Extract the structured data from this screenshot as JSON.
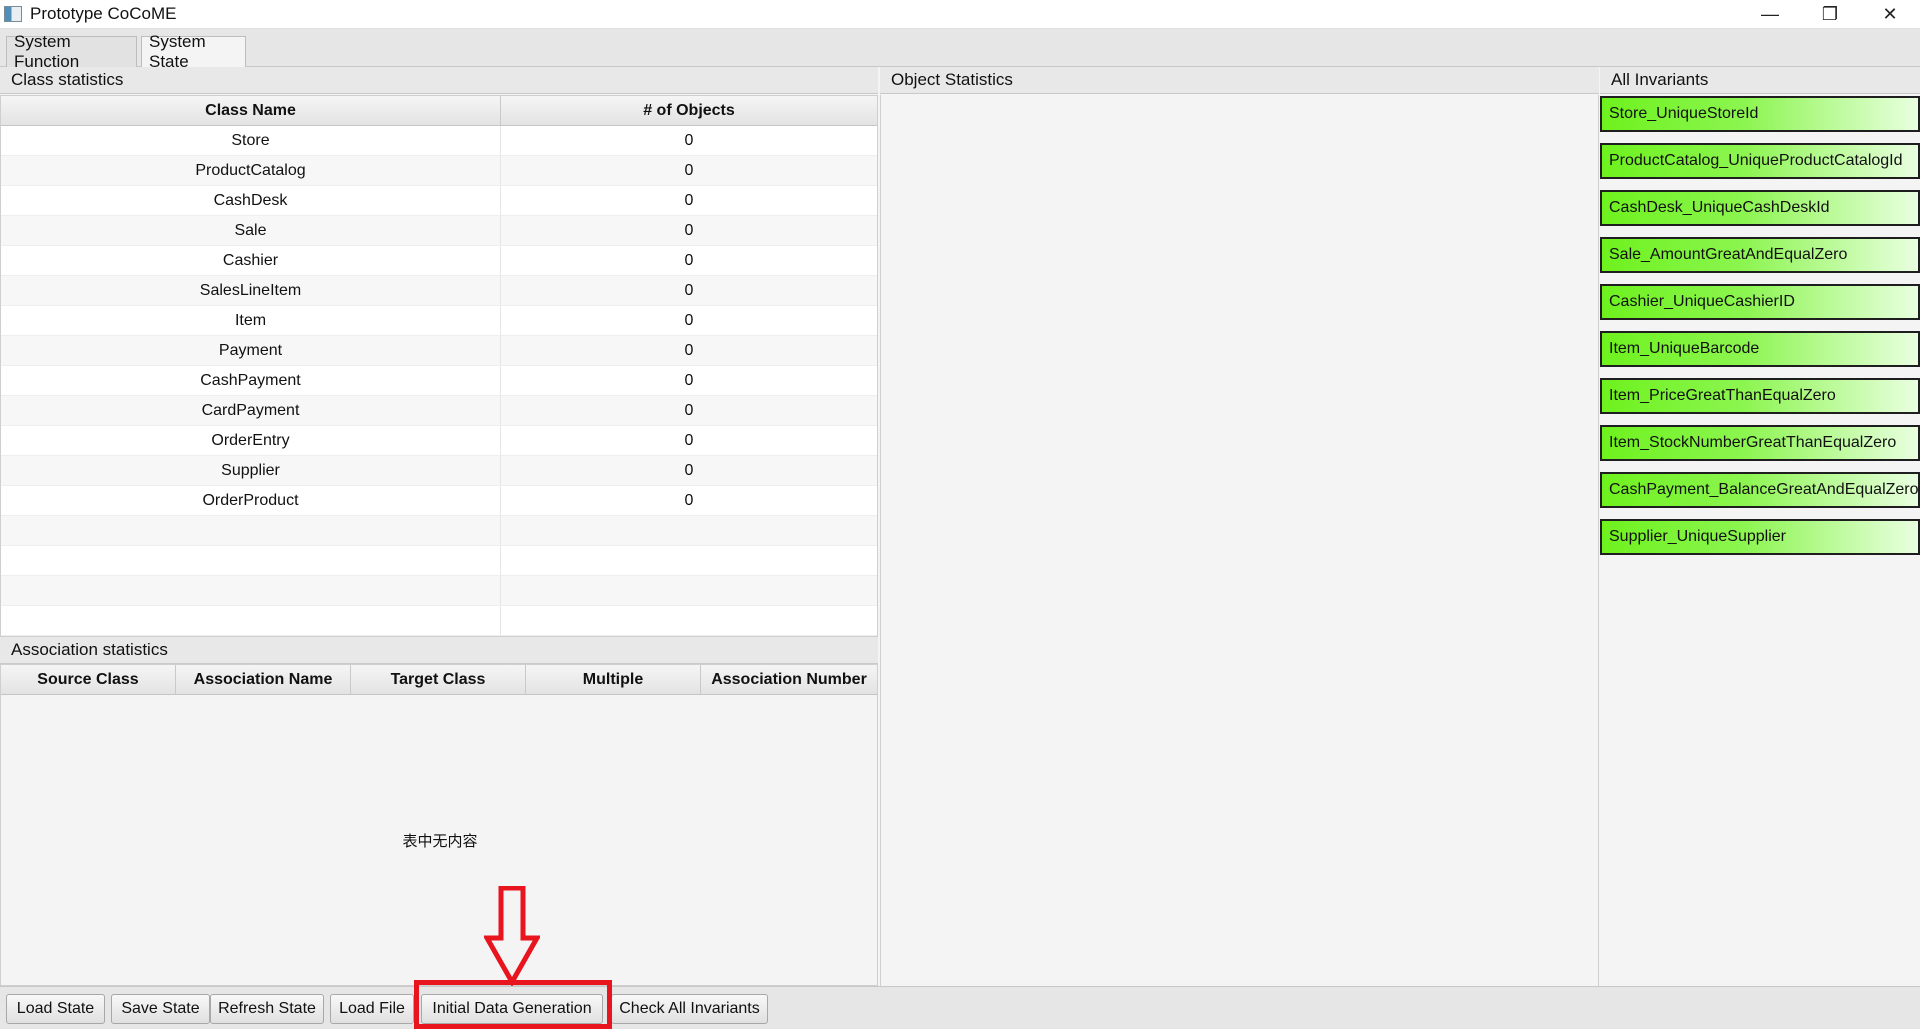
{
  "window": {
    "title": "Prototype CoCoME",
    "minimize_glyph": "—",
    "restore_glyph": "❐",
    "close_glyph": "✕"
  },
  "tabs": [
    {
      "label": "System Function",
      "active": false
    },
    {
      "label": "System State",
      "active": true
    }
  ],
  "class_statistics": {
    "title": "Class statistics",
    "columns": [
      "Class Name",
      "# of Objects"
    ],
    "rows": [
      [
        "Store",
        "0"
      ],
      [
        "ProductCatalog",
        "0"
      ],
      [
        "CashDesk",
        "0"
      ],
      [
        "Sale",
        "0"
      ],
      [
        "Cashier",
        "0"
      ],
      [
        "SalesLineItem",
        "0"
      ],
      [
        "Item",
        "0"
      ],
      [
        "Payment",
        "0"
      ],
      [
        "CashPayment",
        "0"
      ],
      [
        "CardPayment",
        "0"
      ],
      [
        "OrderEntry",
        "0"
      ],
      [
        "Supplier",
        "0"
      ],
      [
        "OrderProduct",
        "0"
      ]
    ]
  },
  "association_statistics": {
    "title": "Association statistics",
    "columns": [
      "Source Class",
      "Association Name",
      "Target Class",
      "Multiple",
      "Association Number"
    ],
    "empty_message": "表中无内容"
  },
  "object_statistics": {
    "title": "Object Statistics"
  },
  "invariants": {
    "title": "All Invariants",
    "items": [
      "Store_UniqueStoreId",
      "ProductCatalog_UniqueProductCatalogId",
      "CashDesk_UniqueCashDeskId",
      "Sale_AmountGreatAndEqualZero",
      "Cashier_UniqueCashierID",
      "Item_UniqueBarcode",
      "Item_PriceGreatThanEqualZero",
      "Item_StockNumberGreatThanEqualZero",
      "CashPayment_BalanceGreatAndEqualZero",
      "Supplier_UniqueSupplier"
    ],
    "status_color": "#6ef21e"
  },
  "toolbar": {
    "buttons": [
      "Load State",
      "Save State",
      "Refresh State",
      "Load File",
      "Initial Data Generation",
      "Check All Invariants"
    ]
  },
  "annotation": {
    "color": "#e8141e",
    "highlighted_button": "Initial Data Generation"
  }
}
